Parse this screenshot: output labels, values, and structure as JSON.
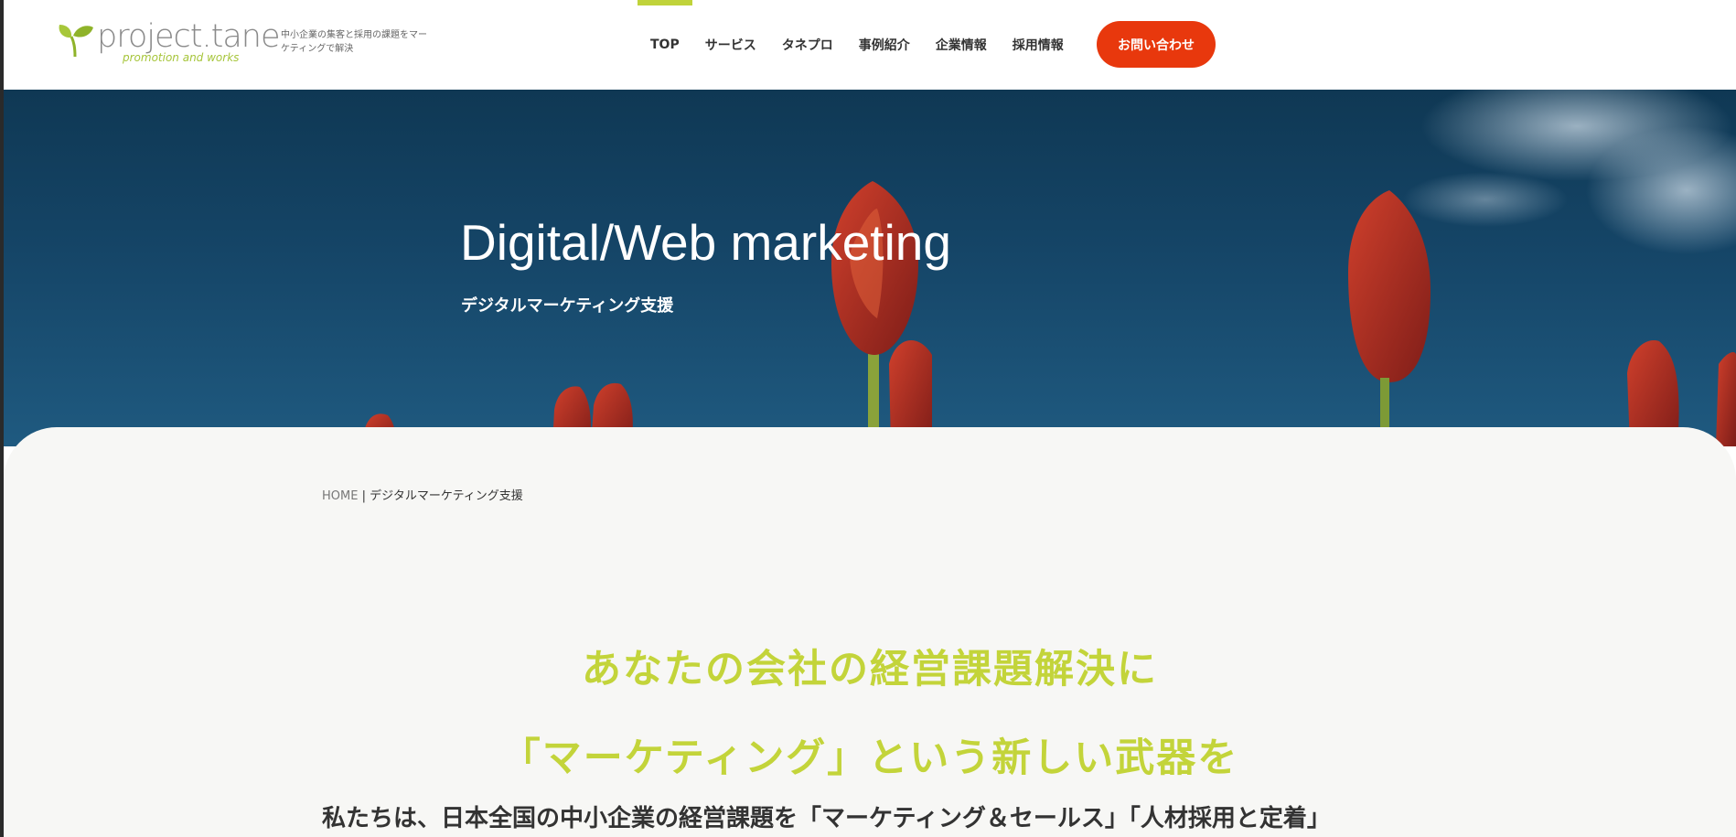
{
  "header": {
    "logo": {
      "name": "project.tane",
      "subline": "promotion and works"
    },
    "tagline": "中小企業の集客と採用の課題をマーケティングで解決",
    "nav": [
      {
        "label": "TOP",
        "active": true
      },
      {
        "label": "サービス",
        "active": false
      },
      {
        "label": "タネプロ",
        "active": false
      },
      {
        "label": "事例紹介",
        "active": false
      },
      {
        "label": "企業情報",
        "active": false
      },
      {
        "label": "採用情報",
        "active": false
      }
    ],
    "contact_label": "お問い合わせ",
    "colors": {
      "accent": "#c0d33a",
      "contact": "#e8380d"
    }
  },
  "hero": {
    "title": "Digital/Web marketing",
    "subtitle": "デジタルマーケティング支援"
  },
  "breadcrumb": {
    "home": "HOME",
    "separator": " | ",
    "current": "デジタルマーケティング支援"
  },
  "main": {
    "headline_line1": "あなたの会社の経営課題解決に",
    "headline_line2": "「マーケティング」という新しい武器を",
    "intro": "私たちは、日本全国の中小企業の経営課題を「マーケティング＆セールス」「人材採用と定着」",
    "headline_color": "#c3d43a"
  }
}
